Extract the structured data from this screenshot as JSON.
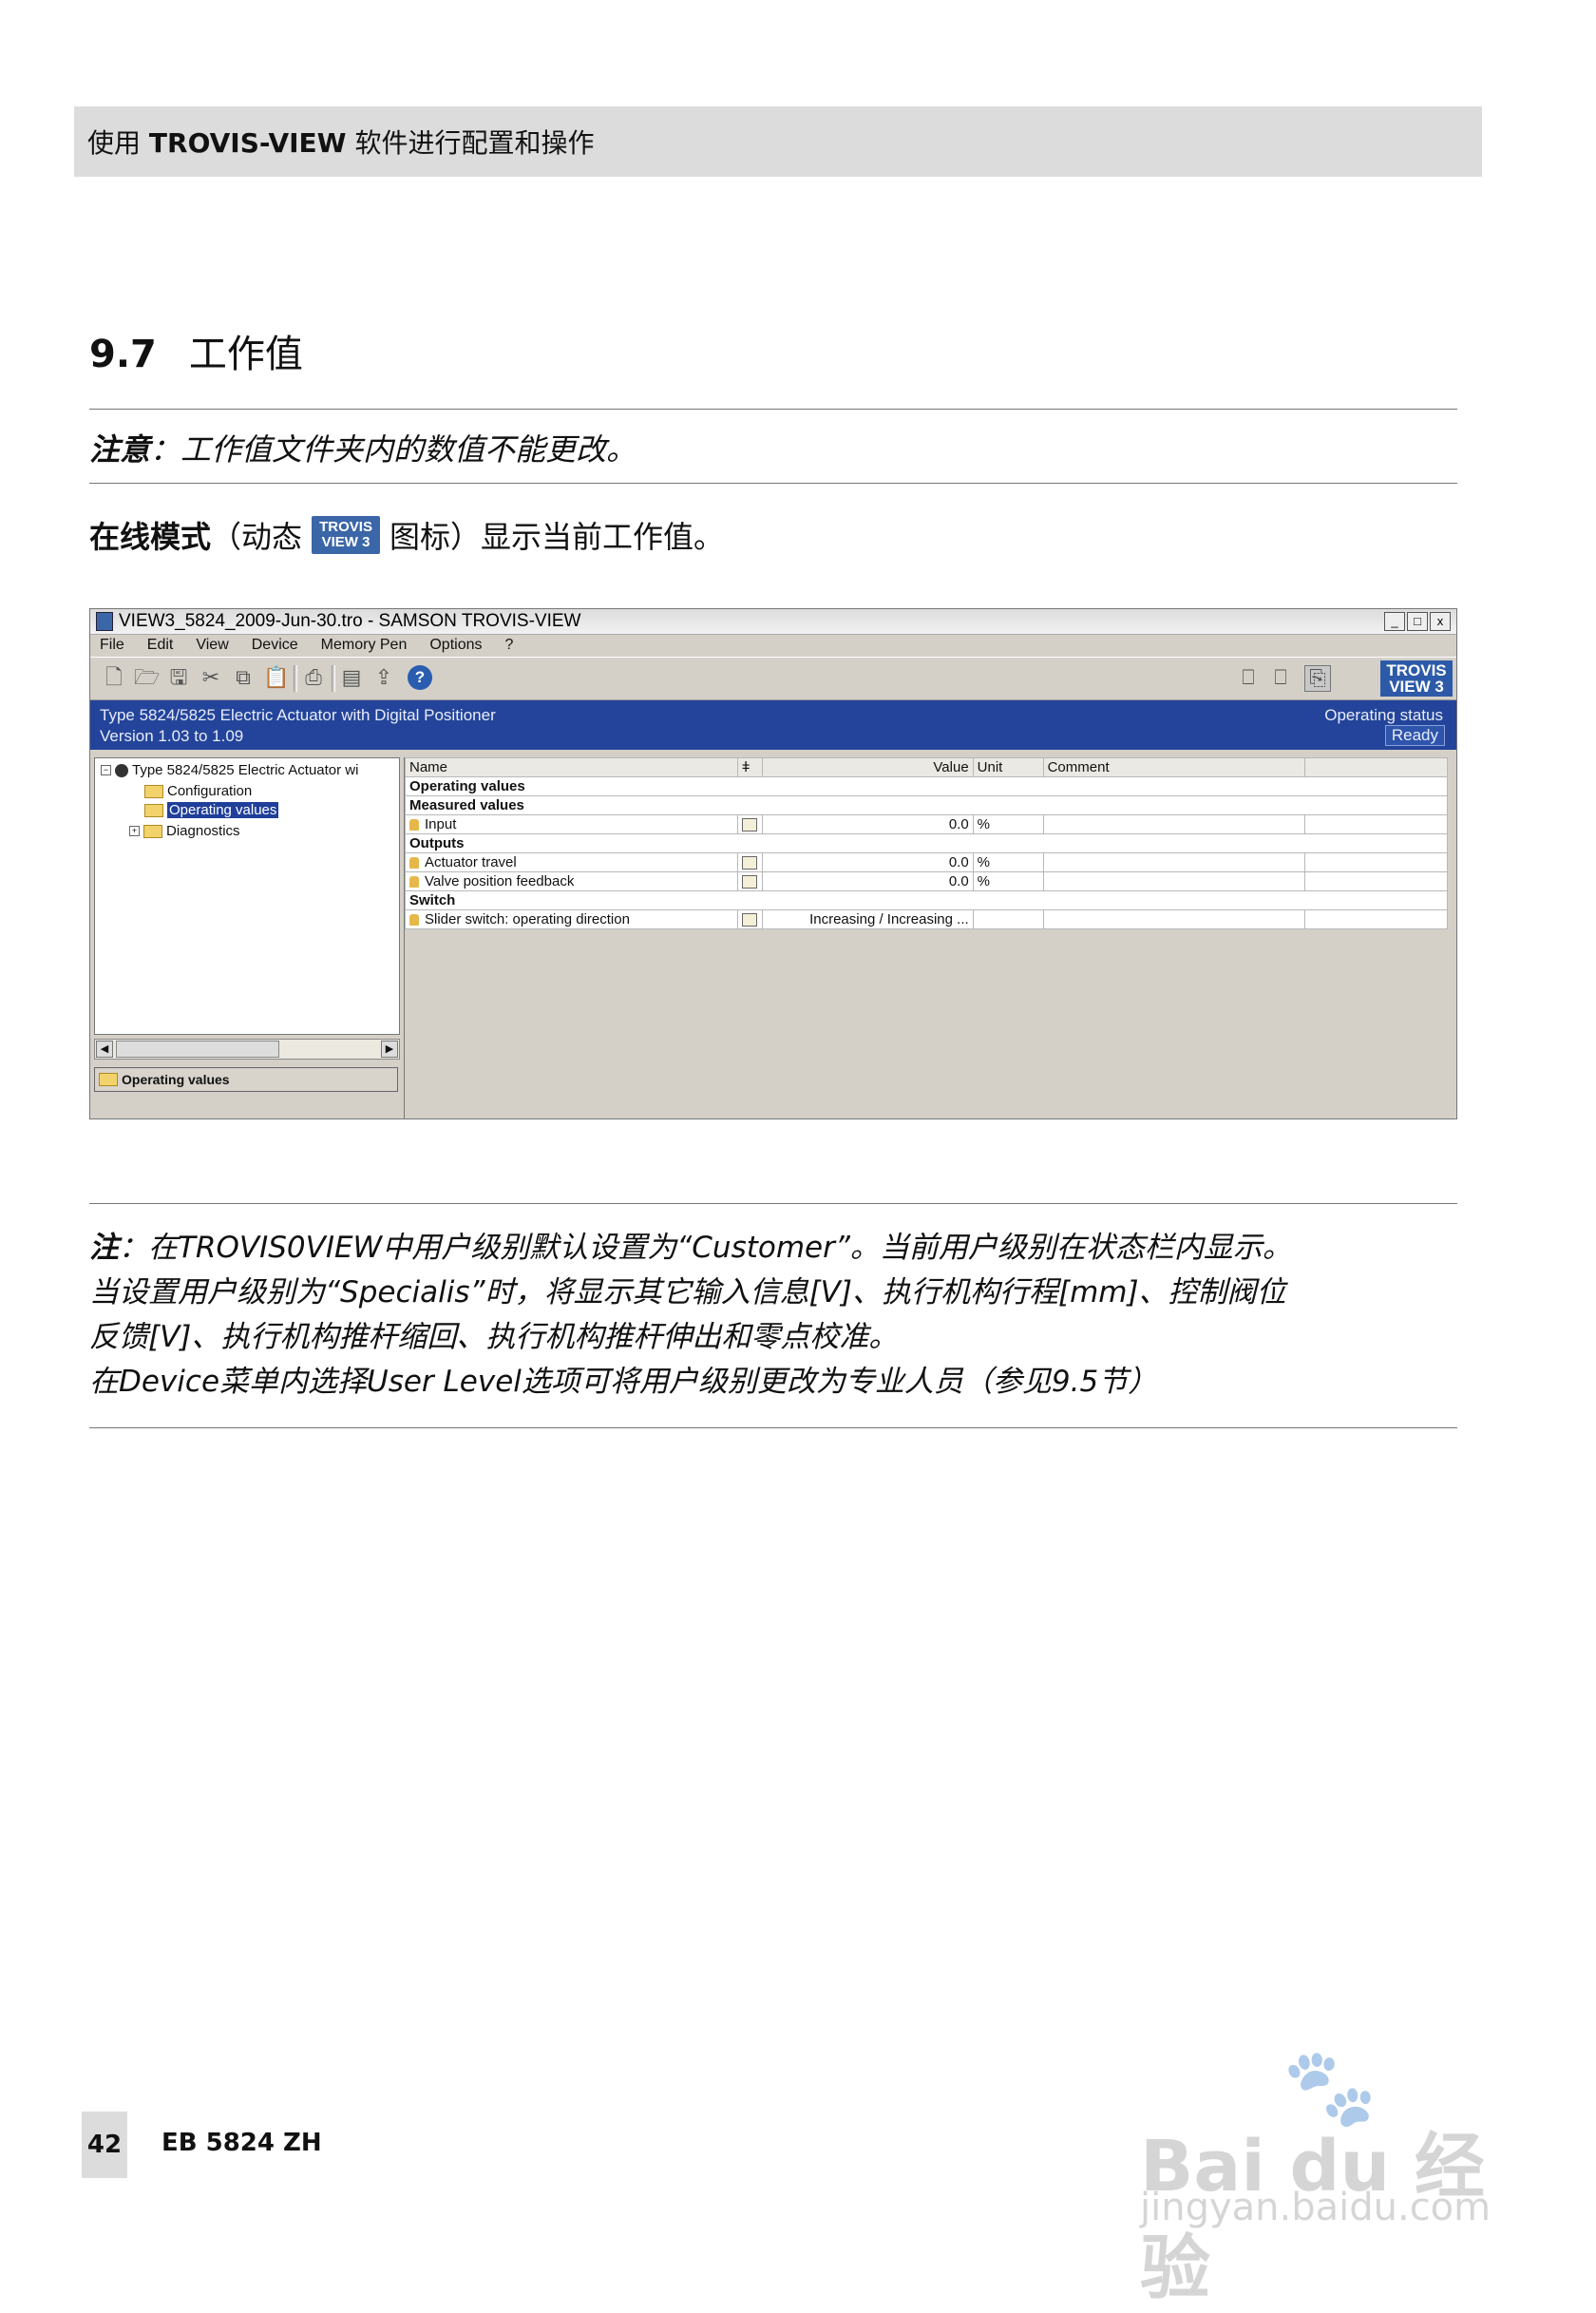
{
  "header": {
    "prefix": "使用 ",
    "brand": "TROVIS-VIEW",
    "suffix": " 软件进行配置和操作"
  },
  "section": {
    "number": "9.7",
    "title": "工作值"
  },
  "note1": {
    "label": "注意",
    "text": "：工作值文件夹内的数值不能更改。"
  },
  "online": {
    "bold": "在线模式",
    "before_icon": "（动态",
    "icon_line1": "TROVIS",
    "icon_line2": "VIEW 3",
    "after_icon": "图标）显示当前工作值。"
  },
  "app": {
    "title": "VIEW3_5824_2009-Jun-30.tro - SAMSON TROVIS-VIEW",
    "window_buttons": [
      "_",
      "□",
      "x"
    ],
    "menu": [
      "File",
      "Edit",
      "View",
      "Device",
      "Memory Pen",
      "Options",
      "?"
    ],
    "logo_line1": "TROVIS",
    "logo_line2": "VIEW 3",
    "device_name": "Type 5824/5825 Electric Actuator with Digital Positioner",
    "version": "Version 1.03 to 1.09",
    "status_label": "Operating status",
    "status_value": "Ready",
    "tree": {
      "root": "Type 5824/5825 Electric Actuator wi",
      "items": [
        "Configuration",
        "Operating values",
        "Diagnostics"
      ]
    },
    "folder_box": "Operating values",
    "columns": {
      "name": "Name",
      "flag": "ǂ",
      "value": "Value",
      "unit": "Unit",
      "comment": "Comment"
    },
    "groups": {
      "operating": "Operating values",
      "measured": "Measured values",
      "outputs": "Outputs",
      "switch": "Switch"
    },
    "rows": {
      "input": {
        "name": "Input",
        "value": "0.0",
        "unit": "%"
      },
      "actuator_travel": {
        "name": "Actuator travel",
        "value": "0.0",
        "unit": "%"
      },
      "valve_feedback": {
        "name": "Valve position feedback",
        "value": "0.0",
        "unit": "%"
      },
      "slider": {
        "name": "Slider switch: operating direction",
        "value": "Increasing / Increasing ..."
      }
    }
  },
  "note2": {
    "label": "注",
    "line1": "：在TROVIS0VIEW中用户级别默认设置为“Customer”。当前用户级别在状态栏内显示。",
    "line2": "当设置用户级别为“Specialis”时，将显示其它输入信息[V]、执行机构行程[mm]、控制阀位",
    "line3": "反馈[V]、执行机构推杆缩回、执行机构推杆伸出和零点校准。",
    "line4": "在Device菜单内选择User Level选项可将用户级别更改为专业人员（参见9.5节）"
  },
  "footer": {
    "page": "42",
    "doc": "EB 5824 ZH"
  },
  "watermark": {
    "brand": "Bai du 经验",
    "url": "jingyan.baidu.com"
  }
}
